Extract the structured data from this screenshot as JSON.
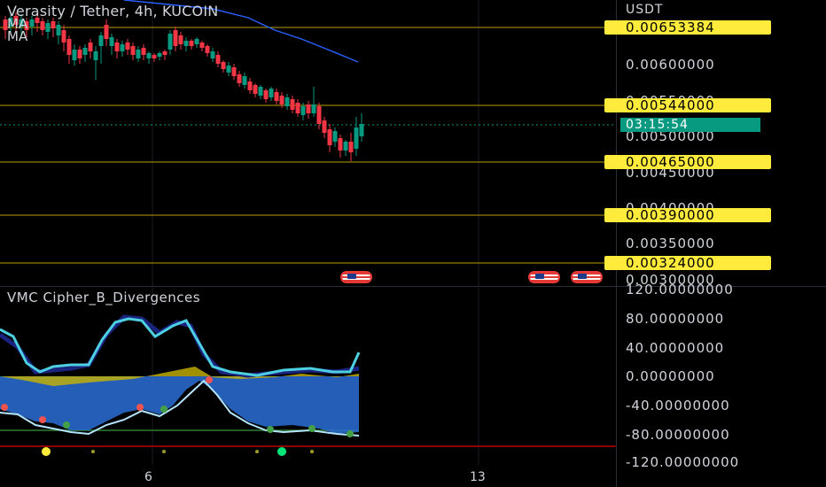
{
  "header": {
    "symbol_title": "Verasity / Tether, 4h, KUCOIN",
    "ma_labels": [
      "MA",
      "MA"
    ]
  },
  "indicator": {
    "title": "VMC Cipher_B_Divergences"
  },
  "price_axis": {
    "unit": "USDT",
    "labels": [
      "0.00600000",
      "0.00550000",
      "0.00500000",
      "0.00450000",
      "0.00400000",
      "0.00350000",
      "0.00300000"
    ]
  },
  "levels": [
    "0.00653384",
    "0.00544000",
    "0.00465000",
    "0.00390000",
    "0.00324000"
  ],
  "countdown": "03:15:54",
  "indicator_axis": {
    "labels": [
      "120.00000000",
      "80.00000000",
      "40.00000000",
      "0.00000000",
      "-40.00000000",
      "-80.00000000",
      "-120.00000000"
    ]
  },
  "time_axis": {
    "labels": [
      "6",
      "13"
    ]
  },
  "colors": {
    "level": "#ffeb3b",
    "up": "#089981",
    "down": "#f23645",
    "ma": "#2962ff",
    "wave": "#4dd0e1",
    "mfi": "#2a6fd6"
  },
  "icons": {
    "event_flags": [
      "us-flag-icon",
      "us-flag-icon",
      "us-flag-icon"
    ]
  }
}
